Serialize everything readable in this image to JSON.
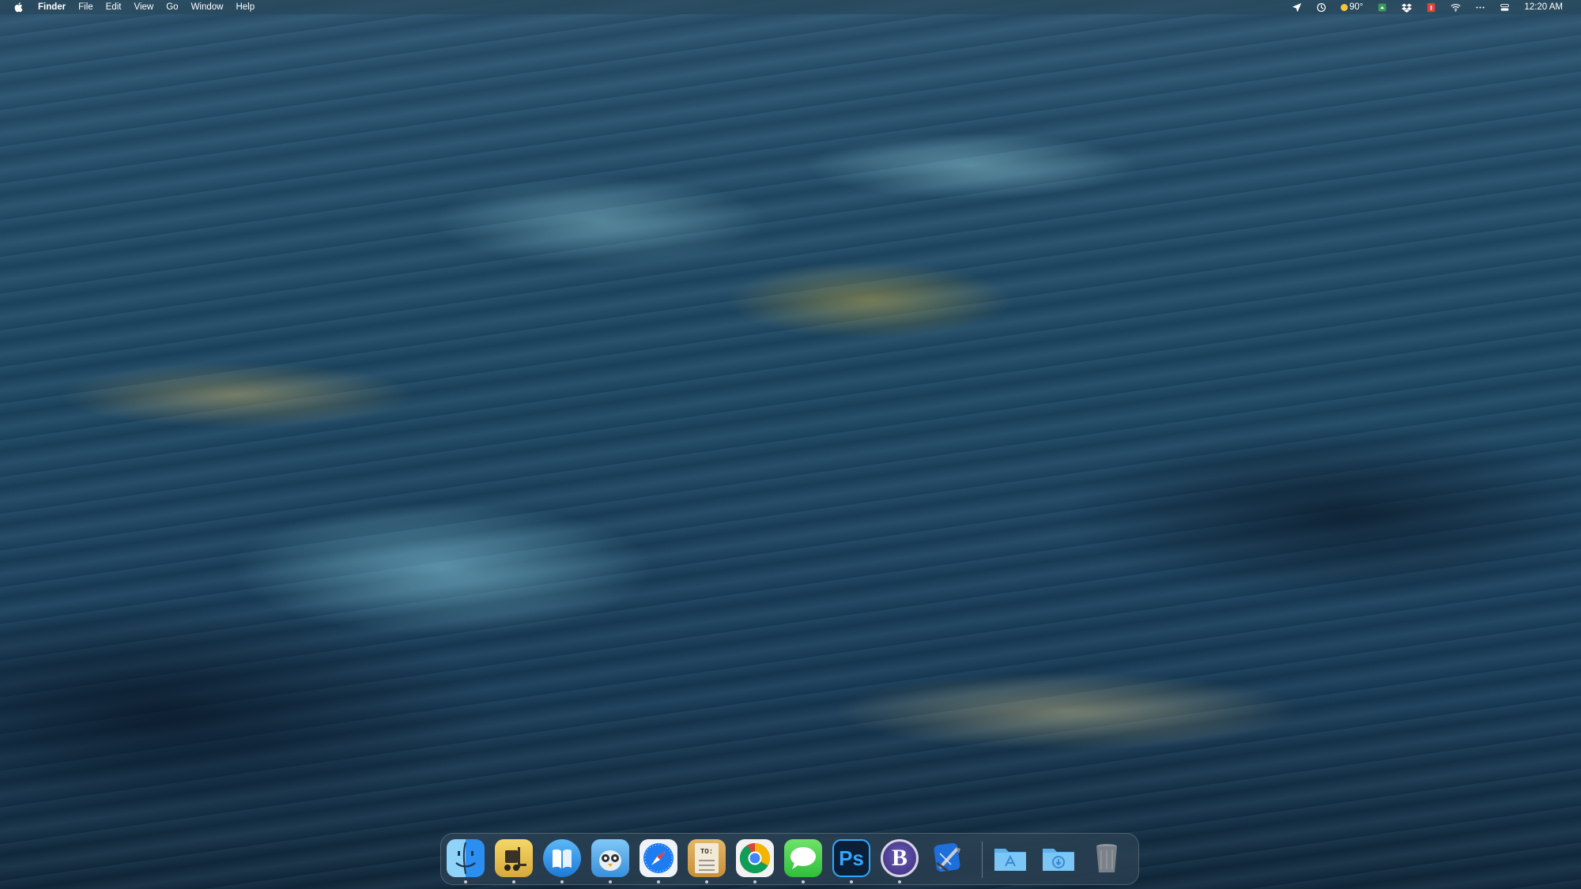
{
  "menubar": {
    "app_name": "Finder",
    "menus": [
      "File",
      "Edit",
      "View",
      "Go",
      "Window",
      "Help"
    ],
    "status": {
      "weather": "90°",
      "clock": "12:20 AM"
    }
  },
  "dock": {
    "apps": [
      {
        "name": "Finder",
        "icon": "finder-icon",
        "running": true
      },
      {
        "name": "Transmit",
        "icon": "forklift-icon",
        "running": true
      },
      {
        "name": "Books",
        "icon": "books-icon",
        "running": true
      },
      {
        "name": "Tweetbot",
        "icon": "tweetbot-icon",
        "running": true
      },
      {
        "name": "Safari",
        "icon": "safari-compass-icon",
        "running": true
      },
      {
        "name": "To-Do",
        "icon": "todo-list-icon",
        "running": true,
        "label": "TO:"
      },
      {
        "name": "Google Chrome",
        "icon": "chrome-icon",
        "running": true
      },
      {
        "name": "Messages",
        "icon": "messages-icon",
        "running": true
      },
      {
        "name": "Photoshop",
        "icon": "photoshop-icon",
        "running": true,
        "label": "Ps"
      },
      {
        "name": "BBEdit",
        "icon": "bbedit-icon",
        "running": true,
        "label": "B"
      },
      {
        "name": "Xcode",
        "icon": "xcode-icon",
        "running": false
      }
    ],
    "stacks": [
      {
        "name": "Applications",
        "icon": "applications-folder-icon"
      },
      {
        "name": "Downloads",
        "icon": "downloads-folder-icon"
      },
      {
        "name": "Trash",
        "icon": "trash-icon"
      }
    ]
  },
  "colors": {
    "menubar_bg": "#2a4a58",
    "accent_blue": "#1e7cf2",
    "ps_blue": "#31a8ff",
    "wallpaper_deep": "#10293d"
  }
}
